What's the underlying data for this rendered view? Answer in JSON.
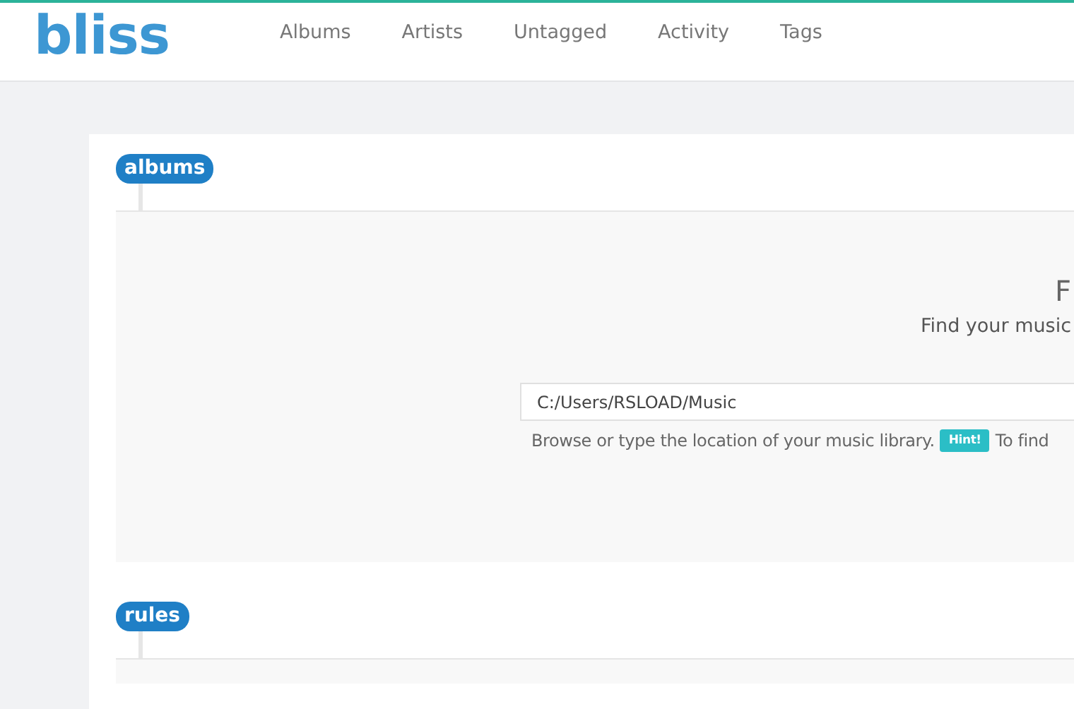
{
  "logo": "bliss",
  "nav": [
    {
      "label": "Albums"
    },
    {
      "label": "Artists"
    },
    {
      "label": "Untagged"
    },
    {
      "label": "Activity"
    },
    {
      "label": "Tags"
    }
  ],
  "sections": [
    {
      "label": "albums",
      "heading": "F",
      "subheading": "Find your music",
      "path_field": {
        "value": "C:/Users/RSLOAD/Music"
      },
      "help_text": "Browse or type the location of your music library.",
      "hint_badge": "Hint!",
      "help_text_after": "To find"
    },
    {
      "label": "rules"
    }
  ]
}
